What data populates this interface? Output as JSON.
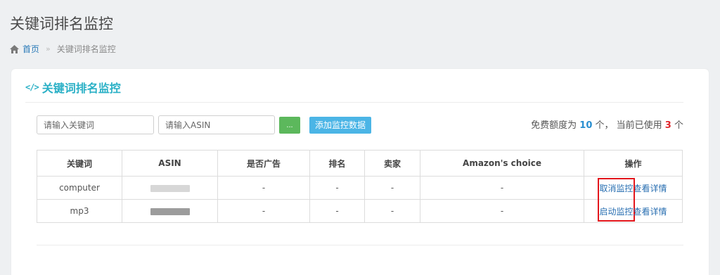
{
  "page": {
    "title": "关键词排名监控"
  },
  "breadcrumb": {
    "home": "首页",
    "separator": "»",
    "current": "关键词排名监控"
  },
  "panel": {
    "icon": "code-icon",
    "title": "关键词排名监控"
  },
  "toolbar": {
    "keyword_placeholder": "请输入关键词",
    "asin_placeholder": "请输入ASIN",
    "search_label": "...",
    "add_label": "添加监控数据"
  },
  "quota": {
    "prefix": "免费额度为",
    "total": "10",
    "mid": "个， 当前已使用",
    "used": "3",
    "suffix": "个"
  },
  "table": {
    "headers": [
      "关键词",
      "ASIN",
      "是否广告",
      "排名",
      "卖家",
      "Amazon's choice",
      "操作"
    ],
    "rows": [
      {
        "keyword": "computer",
        "asin": "",
        "ad": "-",
        "rank": "-",
        "seller": "-",
        "choice": "-",
        "action1": "取消监控",
        "action2": "查看详情"
      },
      {
        "keyword": "mp3",
        "asin": "",
        "ad": "-",
        "rank": "-",
        "seller": "-",
        "choice": "-",
        "action1": "启动监控",
        "action2": "查看详情"
      }
    ]
  },
  "colors": {
    "accent": "#2ab0c6",
    "highlight": "#e3161c",
    "link": "#2a6fb2"
  }
}
